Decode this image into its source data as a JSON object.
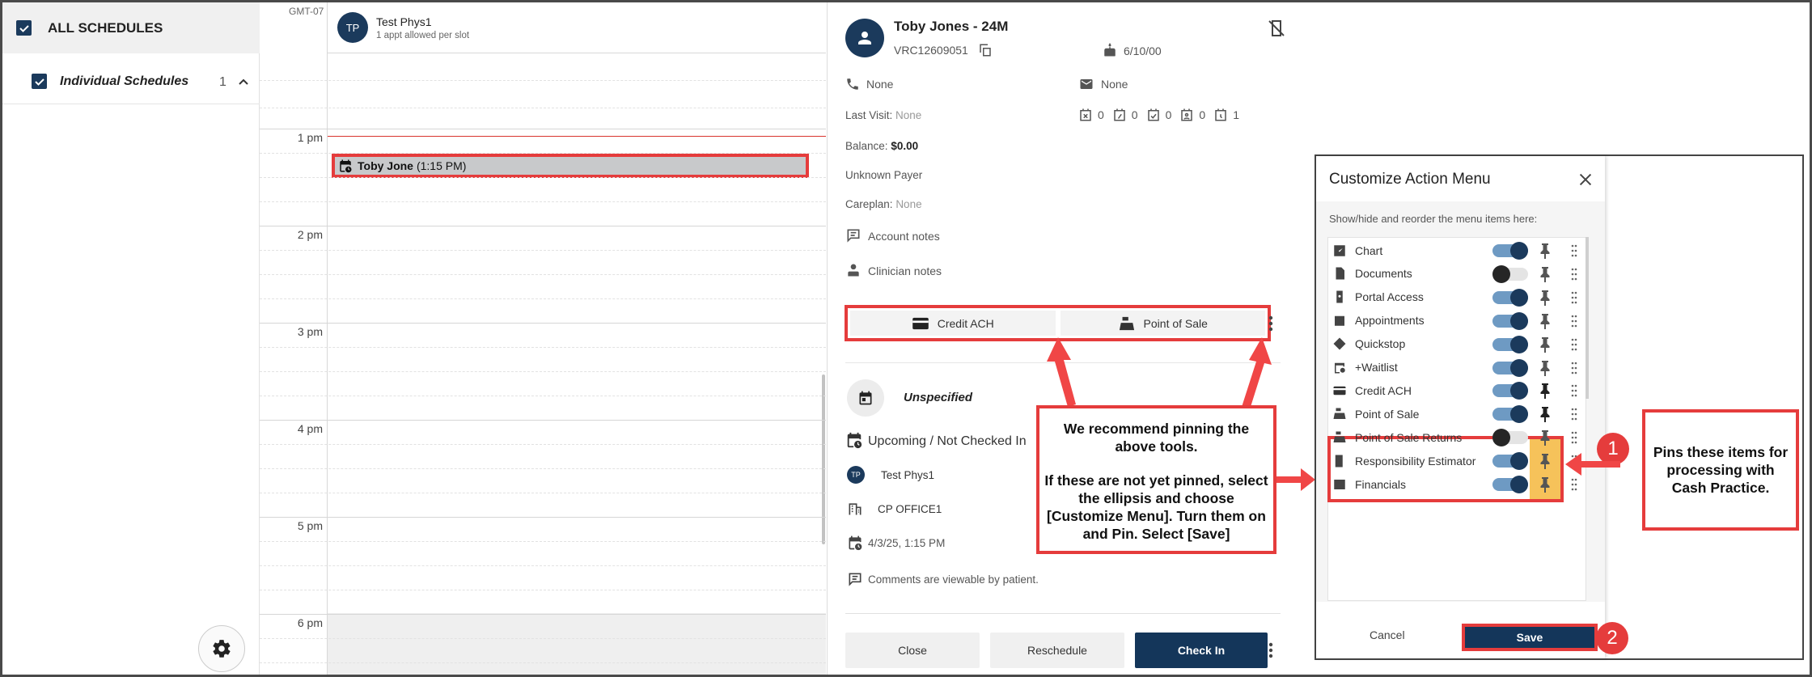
{
  "sidebar": {
    "all_schedules": "ALL SCHEDULES",
    "individual_schedules": "Individual Schedules",
    "individual_count": "1"
  },
  "calendar": {
    "timezone": "GMT-07",
    "provider": {
      "initials": "TP",
      "name": "Test Phys1",
      "sub": "1 appt allowed per slot"
    },
    "hours": [
      "1 pm",
      "2 pm",
      "3 pm",
      "4 pm",
      "5 pm",
      "6 pm"
    ],
    "appointment": {
      "name": "Toby Jone",
      "time": "(1:15 PM)"
    }
  },
  "details": {
    "title": "Toby Jones - 24M",
    "patient_id": "VRC12609051",
    "dob": "6/10/00",
    "phone": "None",
    "email": "None",
    "last_visit_label": "Last Visit:",
    "last_visit_value": "None",
    "counts": [
      "0",
      "0",
      "0",
      "0",
      "1"
    ],
    "balance_label": "Balance:",
    "balance_value": "$0.00",
    "payer": "Unknown Payer",
    "careplan_label": "Careplan:",
    "careplan_value": "None",
    "account_notes": "Account notes",
    "clinician_notes": "Clinician notes",
    "pinned": {
      "credit_ach": "Credit ACH",
      "pos": "Point of Sale"
    },
    "appt_type": "Unspecified",
    "status": "Upcoming / Not Checked In",
    "provider_initials": "TP",
    "provider": "Test Phys1",
    "office": "CP OFFICE1",
    "datetime": "4/3/25, 1:15 PM",
    "comments": "Comments are viewable by patient.",
    "buttons": {
      "close": "Close",
      "reschedule": "Reschedule",
      "checkin": "Check In"
    }
  },
  "callout": {
    "line1": "We recommend pinning the above tools.",
    "line2": "If these are not yet pinned, select the ellipsis and choose [Customize Menu]. Turn them on and Pin. Select [Save]"
  },
  "customize": {
    "title": "Customize Action Menu",
    "subtitle": "Show/hide and reorder the menu items here:",
    "items": [
      {
        "label": "Chart",
        "on": true,
        "pinned": false
      },
      {
        "label": "Documents",
        "on": false,
        "pinned": false
      },
      {
        "label": "Portal Access",
        "on": true,
        "pinned": false
      },
      {
        "label": "Appointments",
        "on": true,
        "pinned": false
      },
      {
        "label": "Quickstop",
        "on": true,
        "pinned": false
      },
      {
        "label": "+Waitlist",
        "on": true,
        "pinned": false
      },
      {
        "label": "Credit ACH",
        "on": true,
        "pinned": true
      },
      {
        "label": "Point of Sale",
        "on": true,
        "pinned": true
      },
      {
        "label": "Point of Sale Returns",
        "on": false,
        "pinned": false
      },
      {
        "label": "Responsibility Estimator",
        "on": true,
        "pinned": false
      },
      {
        "label": "Financials",
        "on": true,
        "pinned": false
      }
    ],
    "cancel": "Cancel",
    "save": "Save",
    "step1": "1",
    "step2": "2",
    "note": "Pins these items for processing with Cash Practice."
  },
  "colors": {
    "navy": "#1b3a5c",
    "accent_red": "#e53c3c",
    "pin_highlight": "#f6c25a"
  }
}
